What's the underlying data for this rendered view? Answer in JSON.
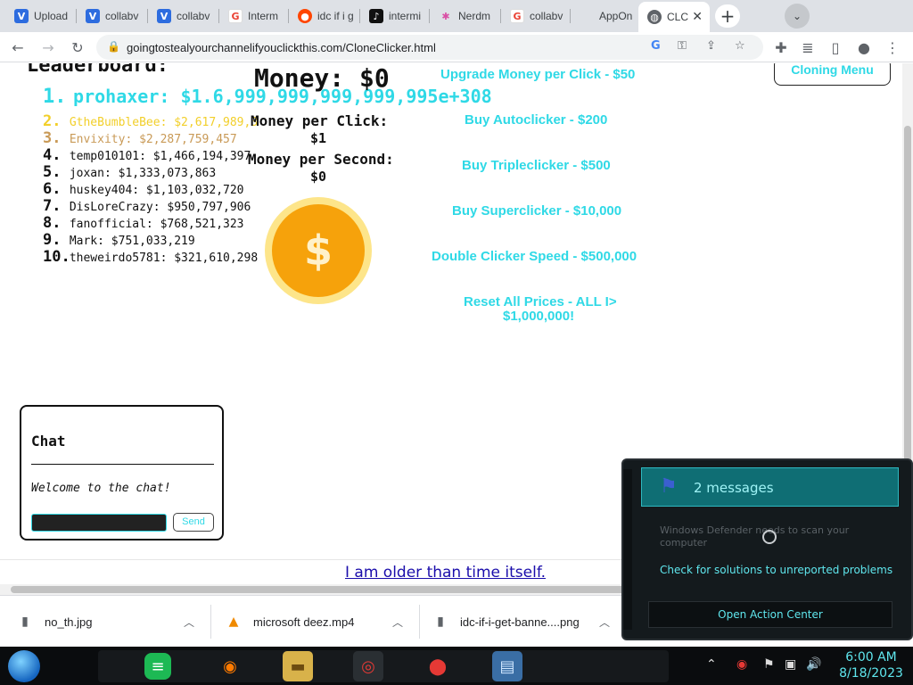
{
  "browser": {
    "tabs": [
      {
        "title": "Upload",
        "icon": "v-logo-icon",
        "color": "#2d6cdf"
      },
      {
        "title": "collabv",
        "icon": "v-logo-icon",
        "color": "#2d6cdf"
      },
      {
        "title": "collabv",
        "icon": "v-logo-icon",
        "color": "#2d6cdf"
      },
      {
        "title": "Interm",
        "icon": "google-icon",
        "color": "#ea4335"
      },
      {
        "title": "idc if i g",
        "icon": "reddit-icon",
        "color": "#ff4500"
      },
      {
        "title": "intermi",
        "icon": "tiktok-icon",
        "color": "#111111"
      },
      {
        "title": "Nerdm",
        "icon": "nerdm-icon",
        "color": "#d94fa5"
      },
      {
        "title": "collabv",
        "icon": "google-icon",
        "color": "#ea4335"
      },
      {
        "title": "AppOn",
        "icon": "apple-icon",
        "color": "#aaaaaa"
      },
      {
        "title": "CLC",
        "icon": "globe-icon",
        "color": "#5f6368"
      }
    ],
    "url": "goingtostealyourchannelifyouclickthis.com/CloneClicker.html"
  },
  "page": {
    "leaderboard_title": "Leaderboard:",
    "leaderboard": [
      {
        "rank": "1.",
        "entry": "prohaxer: $1.6,999,999,999,999,995e+308"
      },
      {
        "rank": "2.",
        "entry": "GtheBumbleBee: $2,617,989,3"
      },
      {
        "rank": "3.",
        "entry": "Envixity: $2,287,759,457"
      },
      {
        "rank": "4.",
        "entry": "temp010101: $1,466,194,397"
      },
      {
        "rank": "5.",
        "entry": "joxan: $1,333,073,863"
      },
      {
        "rank": "6.",
        "entry": "huskey404: $1,103,032,720"
      },
      {
        "rank": "7.",
        "entry": "DisLoreCrazy: $950,797,906"
      },
      {
        "rank": "8.",
        "entry": "fanofficial: $768,521,323"
      },
      {
        "rank": "9.",
        "entry": "Mark: $751,033,219"
      },
      {
        "rank": "10.",
        "entry": "theweirdo5781: $321,610,298"
      }
    ],
    "money": "Money: $0",
    "money_per_click_label": "Money per Click:",
    "money_per_click_value": "$1",
    "money_per_second_label": "Money per Second:",
    "money_per_second_value": "$0",
    "coin_symbol": "$",
    "cloning_menu": "Cloning Menu",
    "shop": [
      "Upgrade Money per Click - $50",
      "Buy Autoclicker - $200",
      "Buy Tripleclicker - $500",
      "Buy Superclicker - $10,000",
      "Double Clicker Speed - $500,000",
      "Reset All Prices - ALL I>",
      "$1,000,000!"
    ],
    "chat": {
      "title": "Chat",
      "welcome": "Welcome to the chat!",
      "send": "Send"
    },
    "footer_link": "I am older than time itself."
  },
  "downloads": [
    {
      "name": "no_th.jpg"
    },
    {
      "name": "microsoft deez.mp4"
    },
    {
      "name": "idc-if-i-get-banne....png"
    }
  ],
  "action_center": {
    "messages": "2 messages",
    "defender": "Windows Defender needs to scan your computer",
    "solutions": "Check for solutions to unreported problems",
    "open": "Open Action Center"
  },
  "taskbar": {
    "time": "6:00 AM",
    "date": "8/18/2023"
  },
  "colors": {
    "accent_cyan": "#2fd9e6",
    "coin_orange": "#f6a20b",
    "link_blue": "#1a0dab"
  }
}
